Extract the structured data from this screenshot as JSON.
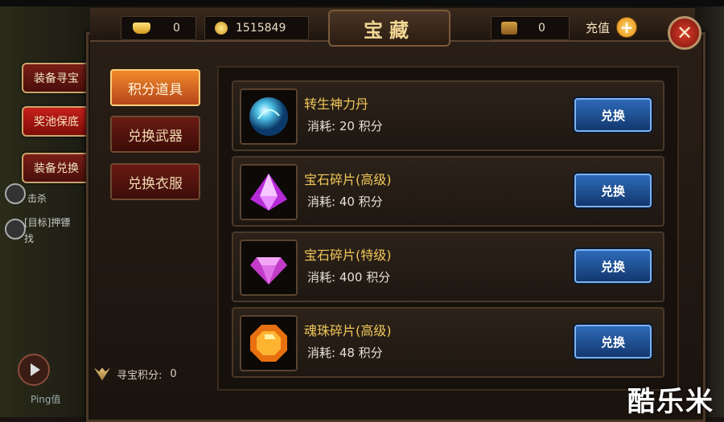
{
  "resources": {
    "ingot_value": "0",
    "coin_value": "1515849",
    "chest_value": "0",
    "recharge_label": "充值"
  },
  "title": "宝藏",
  "side_tabs": [
    {
      "label": "装备寻宝"
    },
    {
      "label": "奖池保底"
    },
    {
      "label": "装备兑换"
    }
  ],
  "side_text": {
    "kill": "击杀",
    "target": "[目标]押镖",
    "find": "找",
    "ping": "Ping值"
  },
  "categories": [
    {
      "label": "积分道具",
      "active": true
    },
    {
      "label": "兑换武器",
      "active": false
    },
    {
      "label": "兑换衣服",
      "active": false
    }
  ],
  "points": {
    "label": "寻宝积分:",
    "value": "0"
  },
  "items": [
    {
      "name": "转生神力丹",
      "cost": "消耗: 20 积分",
      "icon": "blue-orb-icon",
      "button": "兑换"
    },
    {
      "name": "宝石碎片(高级)",
      "cost": "消耗: 40 积分",
      "icon": "purple-gem-icon",
      "button": "兑换"
    },
    {
      "name": "宝石碎片(特级)",
      "cost": "消耗: 400 积分",
      "icon": "pink-diamond-icon",
      "button": "兑换"
    },
    {
      "name": "魂珠碎片(高级)",
      "cost": "消耗: 48 积分",
      "icon": "orange-gem-icon",
      "button": "兑换"
    }
  ],
  "watermark": "酷乐米"
}
